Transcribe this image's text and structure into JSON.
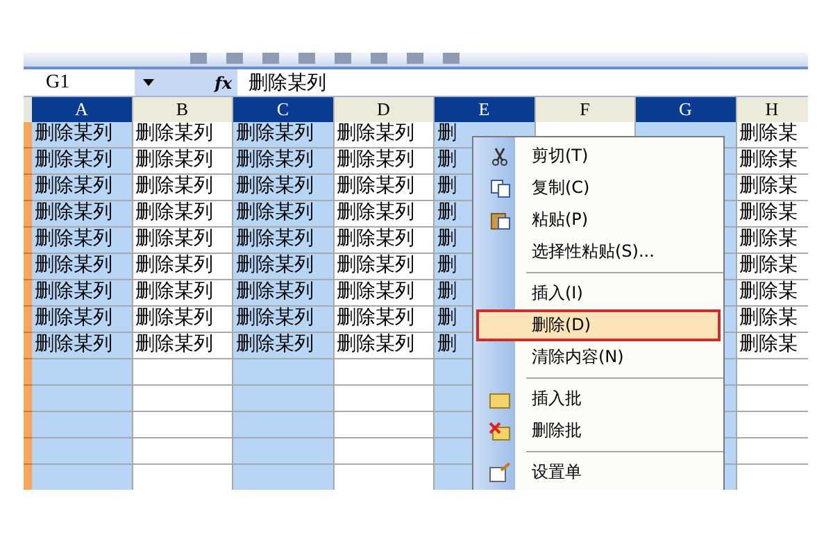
{
  "name_box": {
    "value": "G1"
  },
  "formula_bar": {
    "function_label": "fx",
    "value": "删除某列"
  },
  "columns": [
    {
      "label": "A",
      "selected": true
    },
    {
      "label": "B",
      "selected": false
    },
    {
      "label": "C",
      "selected": true
    },
    {
      "label": "D",
      "selected": false
    },
    {
      "label": "E",
      "selected": true
    },
    {
      "label": "F",
      "selected": false
    },
    {
      "label": "G",
      "selected": true
    },
    {
      "label": "H",
      "selected": false
    }
  ],
  "rows": [
    {
      "cells": [
        "删除某列",
        "删除某列",
        "删除某列",
        "删除某列",
        "删",
        null,
        null,
        "删除某"
      ]
    },
    {
      "cells": [
        "删除某列",
        "删除某列",
        "删除某列",
        "删除某列",
        "删",
        null,
        null,
        "删除某"
      ]
    },
    {
      "cells": [
        "删除某列",
        "删除某列",
        "删除某列",
        "删除某列",
        "删",
        null,
        null,
        "删除某"
      ]
    },
    {
      "cells": [
        "删除某列",
        "删除某列",
        "删除某列",
        "删除某列",
        "删",
        null,
        null,
        "删除某"
      ]
    },
    {
      "cells": [
        "删除某列",
        "删除某列",
        "删除某列",
        "删除某列",
        "删",
        null,
        null,
        "删除某"
      ]
    },
    {
      "cells": [
        "删除某列",
        "删除某列",
        "删除某列",
        "删除某列",
        "删",
        null,
        null,
        "删除某"
      ]
    },
    {
      "cells": [
        "删除某列",
        "删除某列",
        "删除某列",
        "删除某列",
        "删",
        null,
        null,
        "删除某"
      ]
    },
    {
      "cells": [
        "删除某列",
        "删除某列",
        "删除某列",
        "删除某列",
        "删",
        null,
        null,
        "删除某"
      ]
    },
    {
      "cells": [
        "删除某列",
        "删除某列",
        "删除某列",
        "删除某列",
        "删",
        null,
        null,
        "删除某"
      ]
    }
  ],
  "context_menu": [
    {
      "kind": "item",
      "label": "剪切(T)",
      "selected": false
    },
    {
      "kind": "item",
      "label": "复制(C)",
      "selected": false
    },
    {
      "kind": "item",
      "label": "粘贴(P)",
      "selected": false
    },
    {
      "kind": "item",
      "label": "选择性粘贴(S)...",
      "selected": false
    },
    {
      "kind": "separator"
    },
    {
      "kind": "item",
      "label": "插入(I)",
      "selected": false
    },
    {
      "kind": "item",
      "label": "删除(D)",
      "selected": true
    },
    {
      "kind": "item",
      "label": "清除内容(N)",
      "selected": false
    },
    {
      "kind": "separator"
    },
    {
      "kind": "item",
      "label": "插入批",
      "selected": false
    },
    {
      "kind": "item",
      "label": "删除批",
      "selected": false
    },
    {
      "kind": "separator"
    },
    {
      "kind": "item",
      "label": "设置单",
      "selected": false
    }
  ]
}
